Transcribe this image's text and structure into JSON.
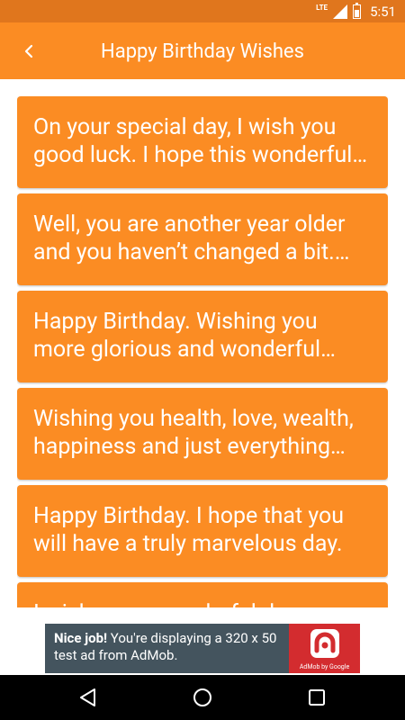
{
  "status_bar": {
    "network": "LTE",
    "time": "5:51"
  },
  "toolbar": {
    "back_icon": "‹",
    "title": "Happy Birthday Wishes"
  },
  "wishes": [
    "On your special day, I wish you good luck. I hope this wonderful day will fill up your heart with joy and blessings.",
    "Well, you are another year older and you haven’t changed a bit. That’s great because you are perfect just the way you are.",
    "Happy Birthday. Wishing you more glorious and wonderful years to come.",
    "Wishing you health, love, wealth, happiness and just everything your heart desires.",
    "Happy Birthday. I hope that you will have a truly marvelous day.",
    "I wish you a wonderful day"
  ],
  "ad": {
    "headline": "Nice job!",
    "body": " You're displaying a 320 x 50 test ad from AdMob.",
    "brand": "AdMob by Google"
  },
  "colors": {
    "status_bar": "#e0761d",
    "toolbar": "#fb8c23",
    "card": "#fb8c23",
    "ad_dark": "#44545e",
    "ad_red": "#d32c2f"
  }
}
